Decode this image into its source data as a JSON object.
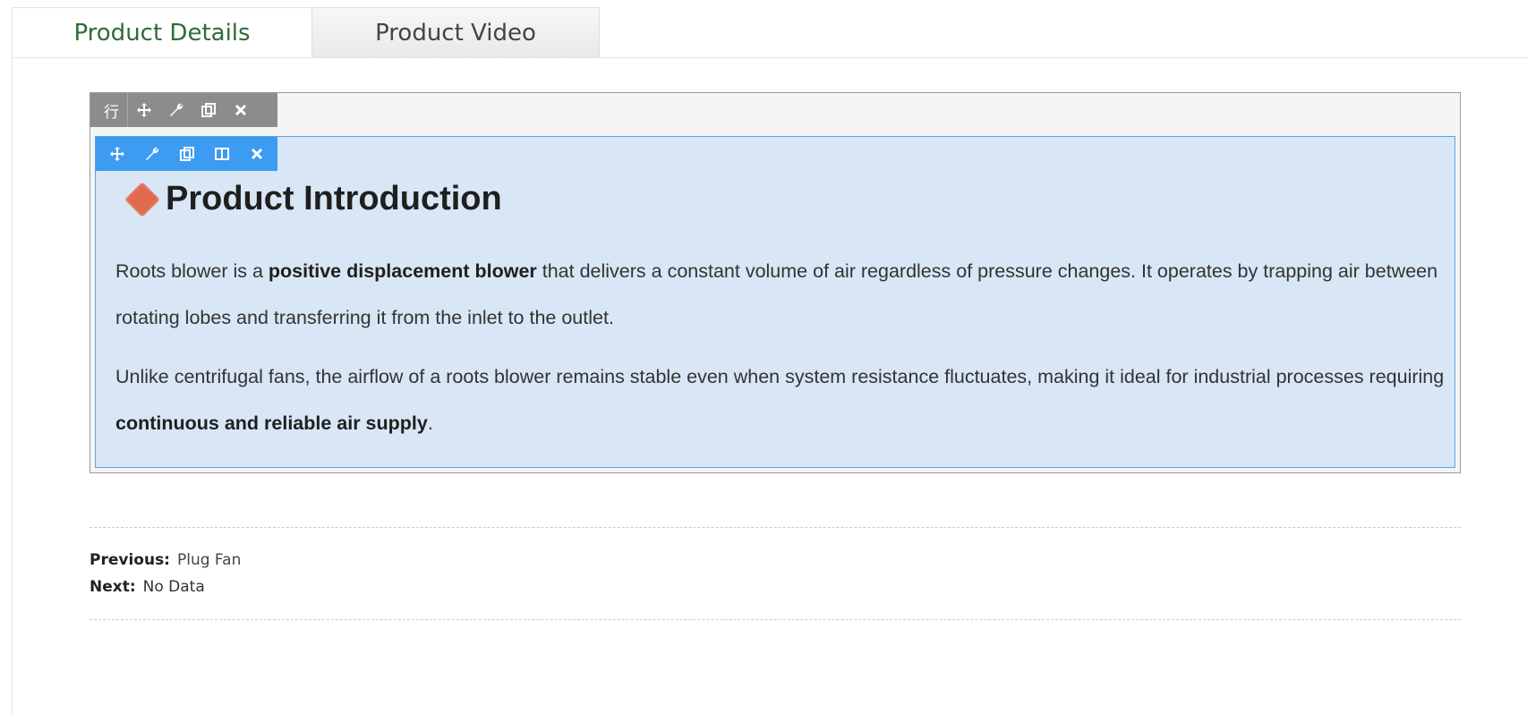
{
  "tabs": [
    {
      "label": "Product Details",
      "active": true
    },
    {
      "label": "Product Video",
      "active": false
    }
  ],
  "row_toolbar": {
    "row_label": "行",
    "icons": [
      "move-icon",
      "wrench-icon",
      "copy-icon",
      "close-icon"
    ]
  },
  "col_toolbar": {
    "icons": [
      "move-icon",
      "wrench-icon",
      "copy-icon",
      "columns-icon",
      "close-icon"
    ]
  },
  "section": {
    "title": "Product Introduction",
    "para1_pre": "Roots blower is a ",
    "para1_bold": "positive displacement blower",
    "para1_post": " that delivers a constant volume of air regardless of pressure changes. It operates by trapping air between rotating lobes and transferring it from the inlet to the outlet.",
    "para2_pre": "Unlike centrifugal fans, the airflow of a roots blower remains stable even when system resistance fluctuates, making it ideal for industrial processes requiring ",
    "para2_bold": "continuous and reliable air supply",
    "para2_post": "."
  },
  "navigation": {
    "previous_label": "Previous:",
    "previous_value": "Plug Fan",
    "next_label": "Next:",
    "next_value": "No Data"
  },
  "colors": {
    "active_tab_text": "#2f6b3a",
    "row_toolbar": "#8c8c8c",
    "col_toolbar": "#3d9bf2",
    "col_background": "#d8e6f5",
    "diamond": "#e0694f"
  }
}
